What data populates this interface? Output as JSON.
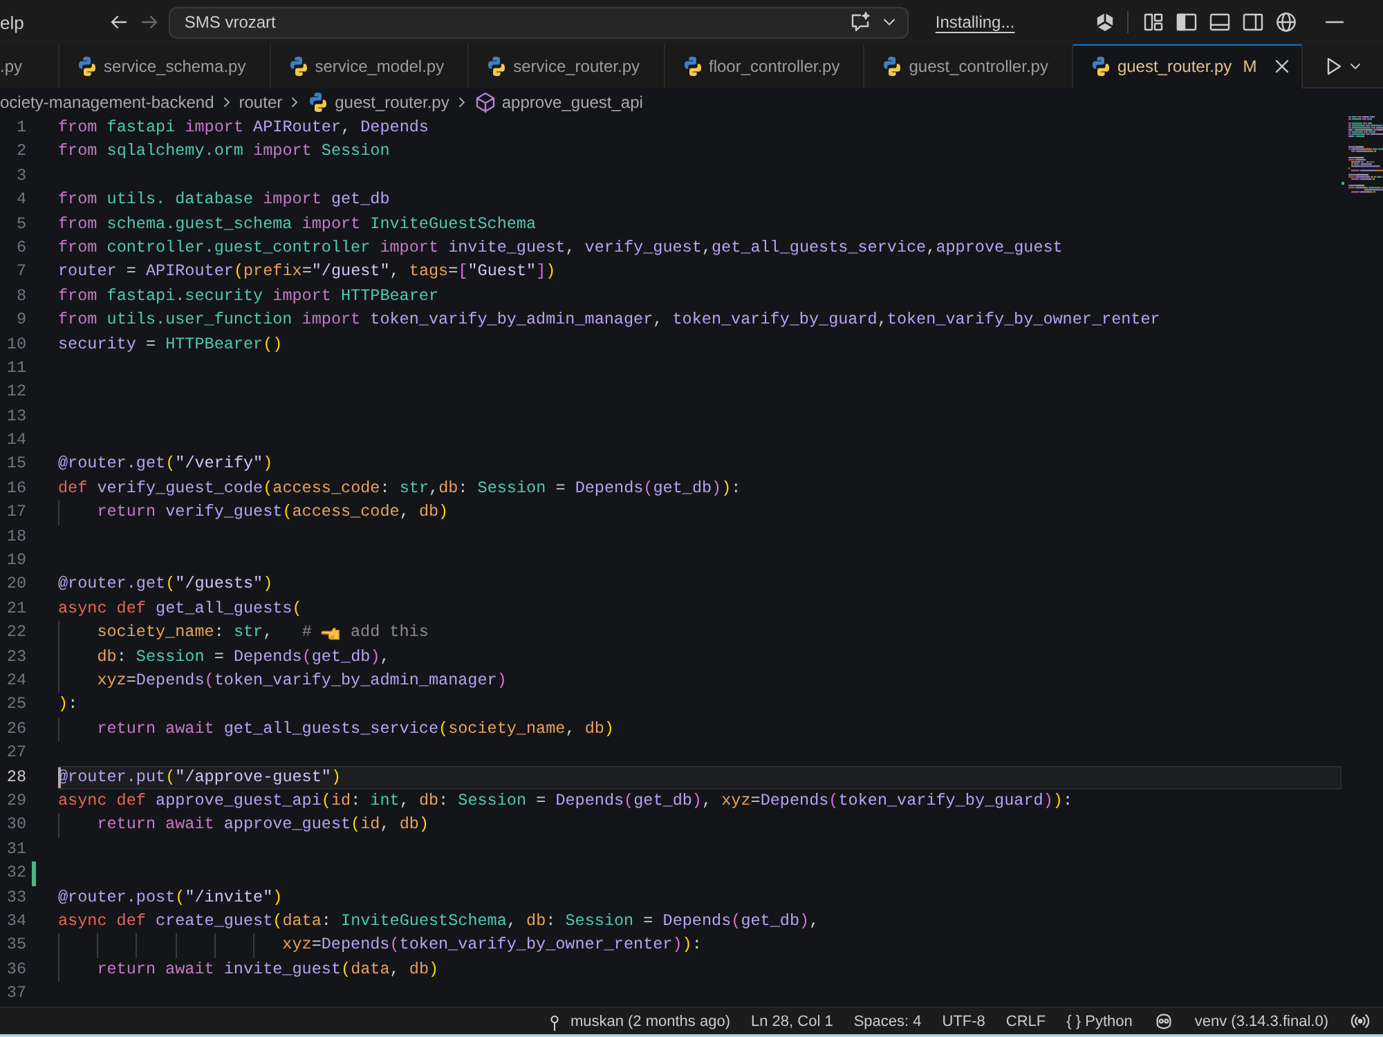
{
  "title_bar": {
    "menu_item": "elp",
    "command_center": "SMS vrozart",
    "progress": "Installing..."
  },
  "tabs": [
    {
      "label": ".py",
      "partial": true,
      "selected": false
    },
    {
      "label": "service_schema.py",
      "partial": false,
      "selected": false
    },
    {
      "label": "service_model.py",
      "partial": false,
      "selected": false
    },
    {
      "label": "service_router.py",
      "partial": false,
      "selected": false
    },
    {
      "label": "floor_controller.py",
      "partial": false,
      "selected": false
    },
    {
      "label": "guest_controller.py",
      "partial": false,
      "selected": false
    },
    {
      "label": "guest_router.py",
      "partial": false,
      "selected": true,
      "badge": "M"
    }
  ],
  "breadcrumb": [
    {
      "kind": "folder",
      "label": "ociety-management-backend"
    },
    {
      "kind": "folder",
      "label": "router"
    },
    {
      "kind": "file",
      "label": "guest_router.py"
    },
    {
      "kind": "symbol",
      "label": "approve_guest_api"
    }
  ],
  "editor": {
    "lines": [
      {
        "number": "1",
        "current": false,
        "modified": false,
        "tokens": [
          {
            "kind": "kw",
            "text": "from "
          },
          {
            "kind": "mod",
            "text": "fastapi "
          },
          {
            "kind": "kw",
            "text": "import "
          },
          {
            "kind": "fn",
            "text": "APIRouter"
          },
          {
            "kind": "p",
            "text": ", "
          },
          {
            "kind": "fn",
            "text": "Depends"
          }
        ]
      },
      {
        "number": "2",
        "current": false,
        "modified": false,
        "tokens": [
          {
            "kind": "kw",
            "text": "from "
          },
          {
            "kind": "mod",
            "text": "sqlalchemy.orm "
          },
          {
            "kind": "kw",
            "text": "import "
          },
          {
            "kind": "type",
            "text": "Session"
          }
        ]
      },
      {
        "number": "3",
        "current": false,
        "modified": false
      },
      {
        "number": "4",
        "current": false,
        "modified": false,
        "tokens": [
          {
            "kind": "kw",
            "text": "from "
          },
          {
            "kind": "mod",
            "text": "utils. database "
          },
          {
            "kind": "kw",
            "text": "import "
          },
          {
            "kind": "fn",
            "text": "get_db"
          }
        ]
      },
      {
        "number": "5",
        "current": false,
        "modified": false,
        "tokens": [
          {
            "kind": "kw",
            "text": "from "
          },
          {
            "kind": "mod",
            "text": "schema.guest_schema "
          },
          {
            "kind": "kw",
            "text": "import "
          },
          {
            "kind": "type",
            "text": "InviteGuestSchema"
          }
        ]
      },
      {
        "number": "6",
        "current": false,
        "modified": false,
        "tokens": [
          {
            "kind": "kw",
            "text": "from "
          },
          {
            "kind": "mod",
            "text": "controller.guest_controller "
          },
          {
            "kind": "kw",
            "text": "import "
          },
          {
            "kind": "fn",
            "text": "invite_guest"
          },
          {
            "kind": "p",
            "text": ", "
          },
          {
            "kind": "fn",
            "text": "verify_guest"
          },
          {
            "kind": "p",
            "text": ","
          },
          {
            "kind": "fn",
            "text": "get_all_guests_service"
          },
          {
            "kind": "p",
            "text": ","
          },
          {
            "kind": "fn",
            "text": "approve_guest"
          }
        ]
      },
      {
        "number": "7",
        "current": false,
        "modified": false,
        "tokens": [
          {
            "kind": "fn",
            "text": "router "
          },
          {
            "kind": "p",
            "text": "= "
          },
          {
            "kind": "fn",
            "text": "APIRouter"
          },
          {
            "kind": "b1",
            "text": "("
          },
          {
            "kind": "param",
            "text": "prefix"
          },
          {
            "kind": "p",
            "text": "="
          },
          {
            "kind": "str",
            "text": "\"/guest\""
          },
          {
            "kind": "p",
            "text": ", "
          },
          {
            "kind": "param",
            "text": "tags"
          },
          {
            "kind": "p",
            "text": "="
          },
          {
            "kind": "b2",
            "text": "["
          },
          {
            "kind": "str",
            "text": "\"Guest\""
          },
          {
            "kind": "b2",
            "text": "]"
          },
          {
            "kind": "b1",
            "text": ")"
          }
        ]
      },
      {
        "number": "8",
        "current": false,
        "modified": false,
        "tokens": [
          {
            "kind": "kw",
            "text": "from "
          },
          {
            "kind": "mod",
            "text": "fastapi.security "
          },
          {
            "kind": "kw",
            "text": "import "
          },
          {
            "kind": "type",
            "text": "HTTPBearer"
          }
        ]
      },
      {
        "number": "9",
        "current": false,
        "modified": false,
        "tokens": [
          {
            "kind": "kw",
            "text": "from "
          },
          {
            "kind": "mod",
            "text": "utils.user_function "
          },
          {
            "kind": "kw",
            "text": "import "
          },
          {
            "kind": "fn",
            "text": "token_varify_by_admin_manager"
          },
          {
            "kind": "p",
            "text": ", "
          },
          {
            "kind": "fn",
            "text": "token_varify_by_guard"
          },
          {
            "kind": "p",
            "text": ","
          },
          {
            "kind": "fn",
            "text": "token_varify_by_owner_renter"
          }
        ]
      },
      {
        "number": "10",
        "current": false,
        "modified": false,
        "tokens": [
          {
            "kind": "fn",
            "text": "security "
          },
          {
            "kind": "p",
            "text": "= "
          },
          {
            "kind": "type",
            "text": "HTTPBearer"
          },
          {
            "kind": "b1",
            "text": "()"
          }
        ]
      },
      {
        "number": "11",
        "current": false,
        "modified": false
      },
      {
        "number": "12",
        "current": false,
        "modified": false
      },
      {
        "number": "13",
        "current": false,
        "modified": false
      },
      {
        "number": "14",
        "current": false,
        "modified": false
      },
      {
        "number": "15",
        "current": false,
        "modified": false,
        "tokens": [
          {
            "kind": "fn",
            "text": "@router.get"
          },
          {
            "kind": "b1",
            "text": "("
          },
          {
            "kind": "str",
            "text": "\"/verify\""
          },
          {
            "kind": "b1",
            "text": ")"
          }
        ]
      },
      {
        "number": "16",
        "current": false,
        "modified": false,
        "tokens": [
          {
            "kind": "def",
            "text": "def "
          },
          {
            "kind": "fn",
            "text": "verify_guest_code"
          },
          {
            "kind": "b1",
            "text": "("
          },
          {
            "kind": "param",
            "text": "access_code"
          },
          {
            "kind": "p",
            "text": ": "
          },
          {
            "kind": "type",
            "text": "str"
          },
          {
            "kind": "p",
            "text": ","
          },
          {
            "kind": "param",
            "text": "db"
          },
          {
            "kind": "p",
            "text": ": "
          },
          {
            "kind": "type",
            "text": "Session "
          },
          {
            "kind": "p",
            "text": "= "
          },
          {
            "kind": "fn",
            "text": "Depends"
          },
          {
            "kind": "b2",
            "text": "("
          },
          {
            "kind": "fn",
            "text": "get_db"
          },
          {
            "kind": "b2",
            "text": ")"
          },
          {
            "kind": "b1",
            "text": ")"
          },
          {
            "kind": "p",
            "text": ":"
          }
        ]
      },
      {
        "number": "17",
        "current": false,
        "modified": false,
        "tokens": [
          {
            "kind": "kw",
            "text": "    return "
          },
          {
            "kind": "fn",
            "text": "verify_guest"
          },
          {
            "kind": "b1",
            "text": "("
          },
          {
            "kind": "param",
            "text": "access_code"
          },
          {
            "kind": "p",
            "text": ", "
          },
          {
            "kind": "param",
            "text": "db"
          },
          {
            "kind": "b1",
            "text": ")"
          }
        ]
      },
      {
        "number": "18",
        "current": false,
        "modified": false
      },
      {
        "number": "19",
        "current": false,
        "modified": false
      },
      {
        "number": "20",
        "current": false,
        "modified": false,
        "tokens": [
          {
            "kind": "fn",
            "text": "@router.get"
          },
          {
            "kind": "b1",
            "text": "("
          },
          {
            "kind": "str",
            "text": "\"/guests\""
          },
          {
            "kind": "b1",
            "text": ")"
          }
        ]
      },
      {
        "number": "21",
        "current": false,
        "modified": false,
        "tokens": [
          {
            "kind": "def",
            "text": "async def "
          },
          {
            "kind": "fn",
            "text": "get_all_guests"
          },
          {
            "kind": "b1",
            "text": "("
          }
        ]
      },
      {
        "number": "22",
        "current": false,
        "modified": false,
        "tokens": [
          {
            "kind": "param",
            "text": "    society_name"
          },
          {
            "kind": "p",
            "text": ": "
          },
          {
            "kind": "type",
            "text": "str"
          },
          {
            "kind": "p",
            "text": ",   "
          },
          {
            "kind": "com",
            "text": "# "
          },
          {
            "kind": "emoji"
          },
          {
            "kind": "com",
            "text": " add this"
          }
        ]
      },
      {
        "number": "23",
        "current": false,
        "modified": false,
        "tokens": [
          {
            "kind": "param",
            "text": "    db"
          },
          {
            "kind": "p",
            "text": ": "
          },
          {
            "kind": "type",
            "text": "Session "
          },
          {
            "kind": "p",
            "text": "= "
          },
          {
            "kind": "fn",
            "text": "Depends"
          },
          {
            "kind": "b2",
            "text": "("
          },
          {
            "kind": "fn",
            "text": "get_db"
          },
          {
            "kind": "b2",
            "text": ")"
          },
          {
            "kind": "p",
            "text": ","
          }
        ]
      },
      {
        "number": "24",
        "current": false,
        "modified": false,
        "tokens": [
          {
            "kind": "param",
            "text": "    xyz"
          },
          {
            "kind": "p",
            "text": "="
          },
          {
            "kind": "fn",
            "text": "Depends"
          },
          {
            "kind": "b2",
            "text": "("
          },
          {
            "kind": "fn",
            "text": "token_varify_by_admin_manager"
          },
          {
            "kind": "b2",
            "text": ")"
          }
        ]
      },
      {
        "number": "25",
        "current": false,
        "modified": false,
        "tokens": [
          {
            "kind": "b1",
            "text": ")"
          },
          {
            "kind": "p",
            "text": ":"
          }
        ]
      },
      {
        "number": "26",
        "current": false,
        "modified": false,
        "tokens": [
          {
            "kind": "kw",
            "text": "    return await "
          },
          {
            "kind": "fn",
            "text": "get_all_guests_service"
          },
          {
            "kind": "b1",
            "text": "("
          },
          {
            "kind": "param",
            "text": "society_name"
          },
          {
            "kind": "p",
            "text": ", "
          },
          {
            "kind": "param",
            "text": "db"
          },
          {
            "kind": "b1",
            "text": ")"
          }
        ]
      },
      {
        "number": "27",
        "current": false,
        "modified": false
      },
      {
        "number": "28",
        "current": true,
        "modified": false,
        "tokens": [
          {
            "kind": "fn",
            "text": "@router.put"
          },
          {
            "kind": "b1",
            "text": "("
          },
          {
            "kind": "str",
            "text": "\"/approve-guest\""
          },
          {
            "kind": "b1",
            "text": ")"
          }
        ]
      },
      {
        "number": "29",
        "current": false,
        "modified": false,
        "tokens": [
          {
            "kind": "def",
            "text": "async def "
          },
          {
            "kind": "fn",
            "text": "approve_guest_api"
          },
          {
            "kind": "b1",
            "text": "("
          },
          {
            "kind": "param",
            "text": "id"
          },
          {
            "kind": "p",
            "text": ": "
          },
          {
            "kind": "type",
            "text": "int"
          },
          {
            "kind": "p",
            "text": ", "
          },
          {
            "kind": "param",
            "text": "db"
          },
          {
            "kind": "p",
            "text": ": "
          },
          {
            "kind": "type",
            "text": "Session "
          },
          {
            "kind": "p",
            "text": "= "
          },
          {
            "kind": "fn",
            "text": "Depends"
          },
          {
            "kind": "b2",
            "text": "("
          },
          {
            "kind": "fn",
            "text": "get_db"
          },
          {
            "kind": "b2",
            "text": ")"
          },
          {
            "kind": "p",
            "text": ", "
          },
          {
            "kind": "param",
            "text": "xyz"
          },
          {
            "kind": "p",
            "text": "="
          },
          {
            "kind": "fn",
            "text": "Depends"
          },
          {
            "kind": "b2",
            "text": "("
          },
          {
            "kind": "fn",
            "text": "token_varify_by_guard"
          },
          {
            "kind": "b2",
            "text": ")"
          },
          {
            "kind": "b1",
            "text": ")"
          },
          {
            "kind": "p",
            "text": ":"
          }
        ]
      },
      {
        "number": "30",
        "current": false,
        "modified": false,
        "tokens": [
          {
            "kind": "kw",
            "text": "    return await "
          },
          {
            "kind": "fn",
            "text": "approve_guest"
          },
          {
            "kind": "b1",
            "text": "("
          },
          {
            "kind": "param",
            "text": "id"
          },
          {
            "kind": "p",
            "text": ", "
          },
          {
            "kind": "param",
            "text": "db"
          },
          {
            "kind": "b1",
            "text": ")"
          }
        ]
      },
      {
        "number": "31",
        "current": false,
        "modified": false
      },
      {
        "number": "32",
        "current": false,
        "modified": true
      },
      {
        "number": "33",
        "current": false,
        "modified": false,
        "tokens": [
          {
            "kind": "fn",
            "text": "@router.post"
          },
          {
            "kind": "b1",
            "text": "("
          },
          {
            "kind": "str",
            "text": "\"/invite\""
          },
          {
            "kind": "b1",
            "text": ")"
          }
        ]
      },
      {
        "number": "34",
        "current": false,
        "modified": false,
        "tokens": [
          {
            "kind": "def",
            "text": "async def "
          },
          {
            "kind": "fn",
            "text": "create_guest"
          },
          {
            "kind": "b1",
            "text": "("
          },
          {
            "kind": "param",
            "text": "data"
          },
          {
            "kind": "p",
            "text": ": "
          },
          {
            "kind": "type",
            "text": "InviteGuestSchema"
          },
          {
            "kind": "p",
            "text": ", "
          },
          {
            "kind": "param",
            "text": "db"
          },
          {
            "kind": "p",
            "text": ": "
          },
          {
            "kind": "type",
            "text": "Session "
          },
          {
            "kind": "p",
            "text": "= "
          },
          {
            "kind": "fn",
            "text": "Depends"
          },
          {
            "kind": "b2",
            "text": "("
          },
          {
            "kind": "fn",
            "text": "get_db"
          },
          {
            "kind": "b2",
            "text": ")"
          },
          {
            "kind": "p",
            "text": ","
          }
        ]
      },
      {
        "number": "35",
        "current": false,
        "modified": false,
        "tokens": [
          {
            "kind": "param",
            "text": "                       xyz"
          },
          {
            "kind": "p",
            "text": "="
          },
          {
            "kind": "fn",
            "text": "Depends"
          },
          {
            "kind": "b2",
            "text": "("
          },
          {
            "kind": "fn",
            "text": "token_varify_by_owner_renter"
          },
          {
            "kind": "b2",
            "text": ")"
          },
          {
            "kind": "b1",
            "text": ")"
          },
          {
            "kind": "p",
            "text": ":"
          }
        ]
      },
      {
        "number": "36",
        "current": false,
        "modified": false,
        "tokens": [
          {
            "kind": "kw",
            "text": "    return await "
          },
          {
            "kind": "fn",
            "text": "invite_guest"
          },
          {
            "kind": "b1",
            "text": "("
          },
          {
            "kind": "param",
            "text": "data"
          },
          {
            "kind": "p",
            "text": ", "
          },
          {
            "kind": "param",
            "text": "db"
          },
          {
            "kind": "b1",
            "text": ")"
          }
        ]
      },
      {
        "number": "37",
        "current": false,
        "modified": false
      }
    ]
  },
  "status_bar": {
    "blame": "muskan (2 months ago)",
    "cursor": "Ln 28, Col 1",
    "indentation": "Spaces: 4",
    "encoding": "UTF-8",
    "line_ending": "CRLF",
    "language_glyph": "{ }",
    "language": "Python",
    "interpreter": "venv (3.14.3.final.0)"
  }
}
